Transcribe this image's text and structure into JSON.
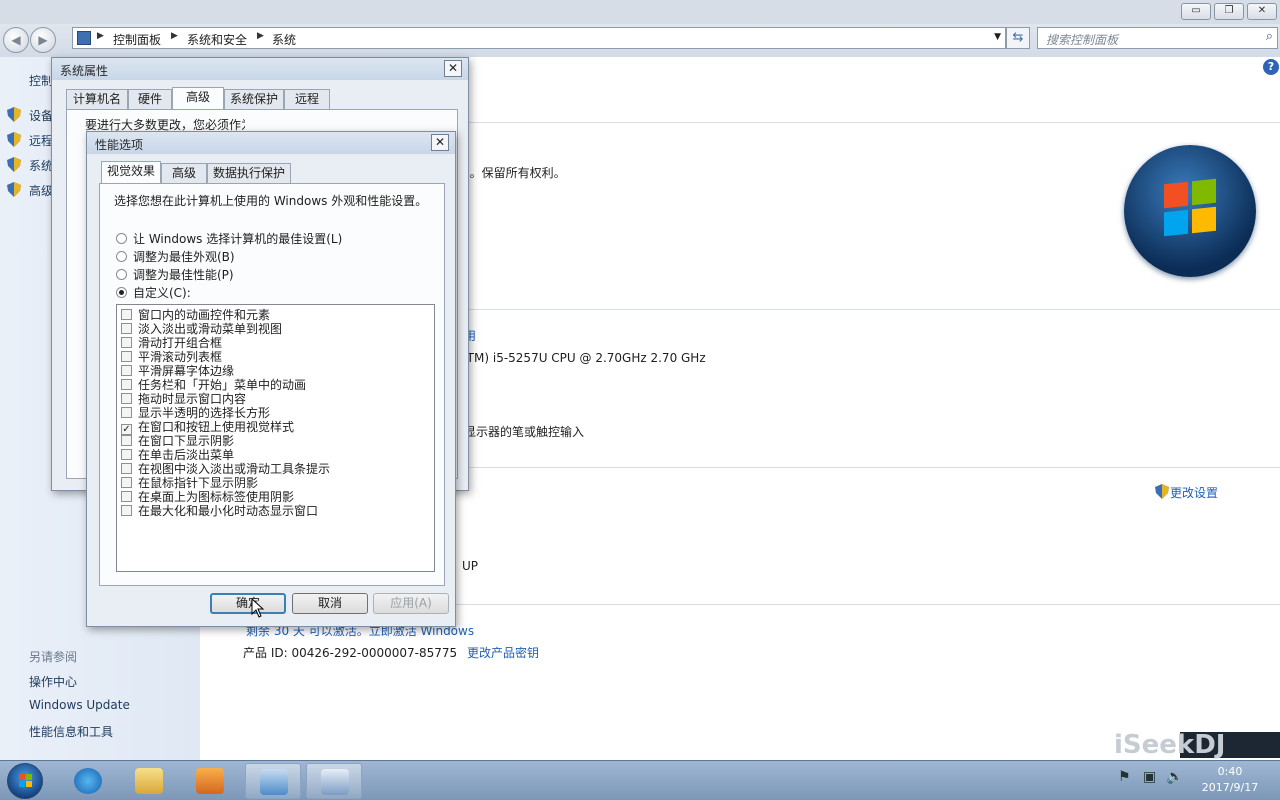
{
  "explorer": {
    "breadcrumb": [
      "控制面板",
      "系统和安全",
      "系统"
    ],
    "search_placeholder": "搜索控制面板",
    "window_controls": [
      "▭",
      "❐",
      "✕"
    ]
  },
  "left_pane": {
    "top_link": "控制",
    "items": [
      "设备",
      "远程",
      "系统",
      "高级"
    ],
    "see_also_title": "另请参阅",
    "see_also": [
      "操作中心",
      "Windows Update",
      "性能信息和工具"
    ]
  },
  "main": {
    "copyright": "n。保留所有权利。",
    "rating_link": "用",
    "processor": "(TM) i5-5257U CPU @ 2.70GHz   2.70 GHz",
    "pen_touch": "显示器的笔或触控输入",
    "change_settings": "更改设置",
    "workgroup_fragment": "UP",
    "activation": "剩余 30 天 可以激活。立即激活 Windows",
    "product_id_label": "产品 ID: 00426-292-0000007-85775",
    "change_key": "更改产品密钥",
    "help_icon": "?"
  },
  "system_properties": {
    "title": "系统属性",
    "close": "✕",
    "tabs": [
      "计算机名",
      "硬件",
      "高级",
      "系统保护",
      "远程"
    ],
    "active_tab": "高级",
    "partial_text": "要进行大多数更改，您必须作为管理员登录。"
  },
  "performance_options": {
    "title": "性能选项",
    "close": "✕",
    "tabs": [
      "视觉效果",
      "高级",
      "数据执行保护"
    ],
    "active_tab": "视觉效果",
    "intro": "选择您想在此计算机上使用的 Windows 外观和性能设置。",
    "radios": [
      {
        "label": "让 Windows 选择计算机的最佳设置(L)",
        "selected": false
      },
      {
        "label": "调整为最佳外观(B)",
        "selected": false
      },
      {
        "label": "调整为最佳性能(P)",
        "selected": false
      },
      {
        "label": "自定义(C):",
        "selected": true
      }
    ],
    "effects": [
      {
        "label": "窗口内的动画控件和元素",
        "checked": false
      },
      {
        "label": "淡入淡出或滑动菜单到视图",
        "checked": false
      },
      {
        "label": "滑动打开组合框",
        "checked": false
      },
      {
        "label": "平滑滚动列表框",
        "checked": false
      },
      {
        "label": "平滑屏幕字体边缘",
        "checked": false
      },
      {
        "label": "任务栏和「开始」菜单中的动画",
        "checked": false
      },
      {
        "label": "拖动时显示窗口内容",
        "checked": false
      },
      {
        "label": "显示半透明的选择长方形",
        "checked": false
      },
      {
        "label": "在窗口和按钮上使用视觉样式",
        "checked": true
      },
      {
        "label": "在窗口下显示阴影",
        "checked": false
      },
      {
        "label": "在单击后淡出菜单",
        "checked": false
      },
      {
        "label": "在视图中淡入淡出或滑动工具条提示",
        "checked": false
      },
      {
        "label": "在鼠标指针下显示阴影",
        "checked": false
      },
      {
        "label": "在桌面上为图标标签使用阴影",
        "checked": false
      },
      {
        "label": "在最大化和最小化时动态显示窗口",
        "checked": false
      }
    ],
    "buttons": {
      "ok": "确定",
      "cancel": "取消",
      "apply": "应用(A)"
    }
  },
  "taskbar": {
    "time": "0:40",
    "date": "2017/9/17"
  },
  "watermark": "iSeekDJ",
  "colors": {
    "accent_link": "#1f5fb8",
    "titlebar": "#c8d6e8",
    "taskbar": "#8aa4c3"
  }
}
